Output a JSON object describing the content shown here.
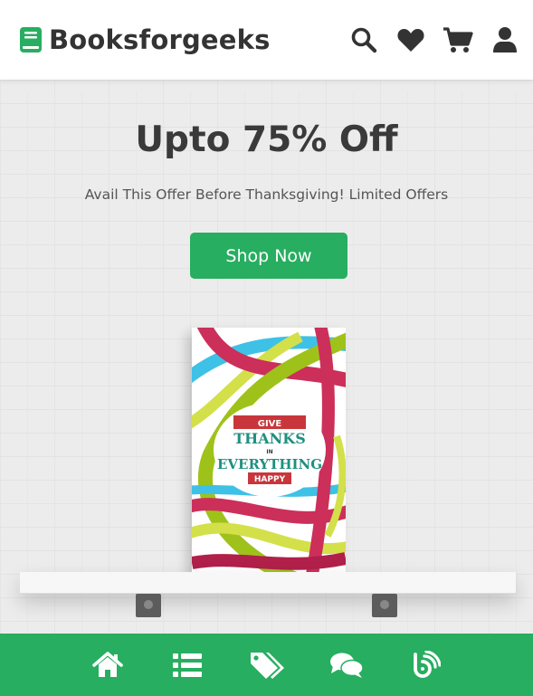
{
  "header": {
    "logo_text": "Booksforgeeks",
    "icons": [
      "search-icon",
      "heart-icon",
      "cart-icon",
      "user-icon"
    ]
  },
  "hero": {
    "title": "Upto 75% Off",
    "subtitle": "Avail This Offer Before Thanksgiving! Limited Offers",
    "button_label": "Shop Now",
    "book_cover": {
      "line1": "GIVE",
      "line2": "THANKS",
      "line3": "IN",
      "line4": "EVERYTHING",
      "line5": "HAPPY"
    }
  },
  "bottom_nav": {
    "items": [
      "home-icon",
      "list-icon",
      "tags-icon",
      "comments-icon",
      "blog-icon"
    ]
  },
  "colors": {
    "brand_green": "#27ae60",
    "text_dark": "#333333",
    "hero_bg": "#ececec"
  }
}
